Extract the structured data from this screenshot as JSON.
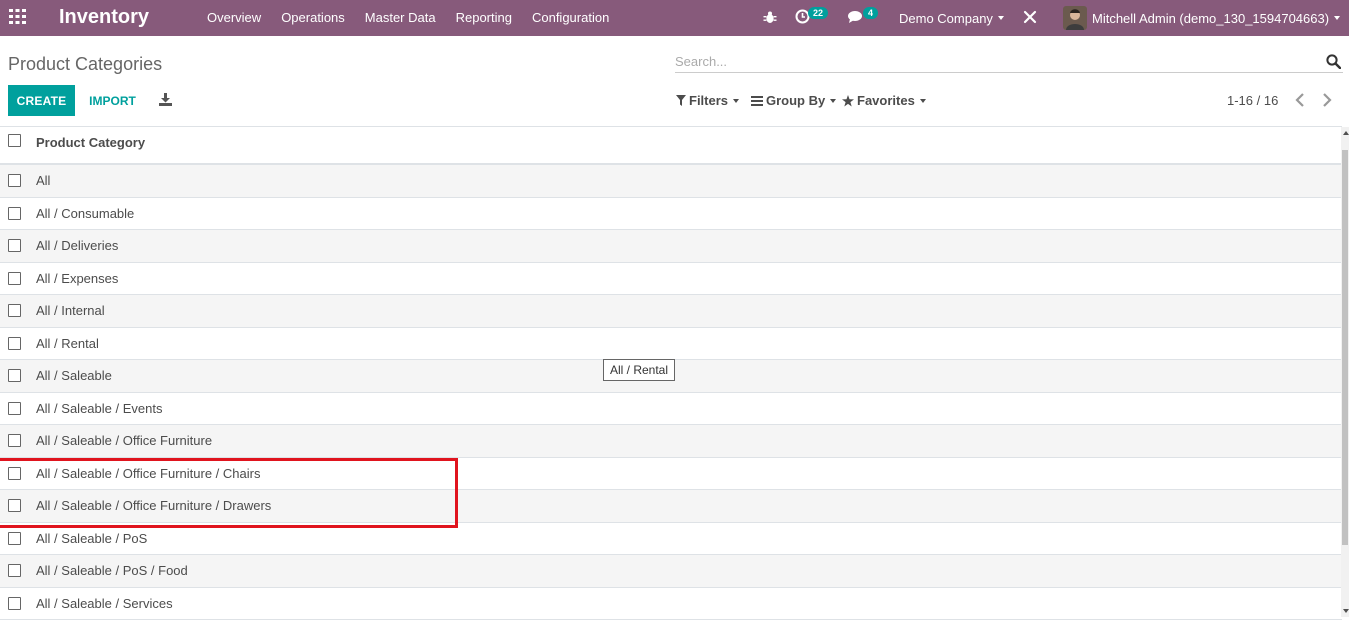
{
  "navbar": {
    "app_title": "Inventory",
    "menu": [
      "Overview",
      "Operations",
      "Master Data",
      "Reporting",
      "Configuration"
    ],
    "activity_count": "22",
    "message_count": "4",
    "company": "Demo Company",
    "user": "Mitchell Admin (demo_130_1594704663)",
    "bg_color": "#875a7b"
  },
  "control_panel": {
    "title": "Product Categories",
    "search_placeholder": "Search...",
    "create_label": "CREATE",
    "import_label": "IMPORT",
    "filters_label": "Filters",
    "group_by_label": "Group By",
    "favorites_label": "Favorites",
    "pager": "1-16 / 16",
    "accent_color": "#00a09d"
  },
  "list": {
    "column_header": "Product Category",
    "rows": [
      "All",
      "All / Consumable",
      "All / Deliveries",
      "All / Expenses",
      "All / Internal",
      "All / Rental",
      "All / Saleable",
      "All / Saleable / Events",
      "All / Saleable / Office Furniture",
      "All / Saleable / Office Furniture / Chairs",
      "All / Saleable / Office Furniture / Drawers",
      "All / Saleable / PoS",
      "All / Saleable / PoS / Food",
      "All / Saleable / Services"
    ]
  },
  "tooltip": "All / Rental",
  "highlight_color": "#e0141e"
}
